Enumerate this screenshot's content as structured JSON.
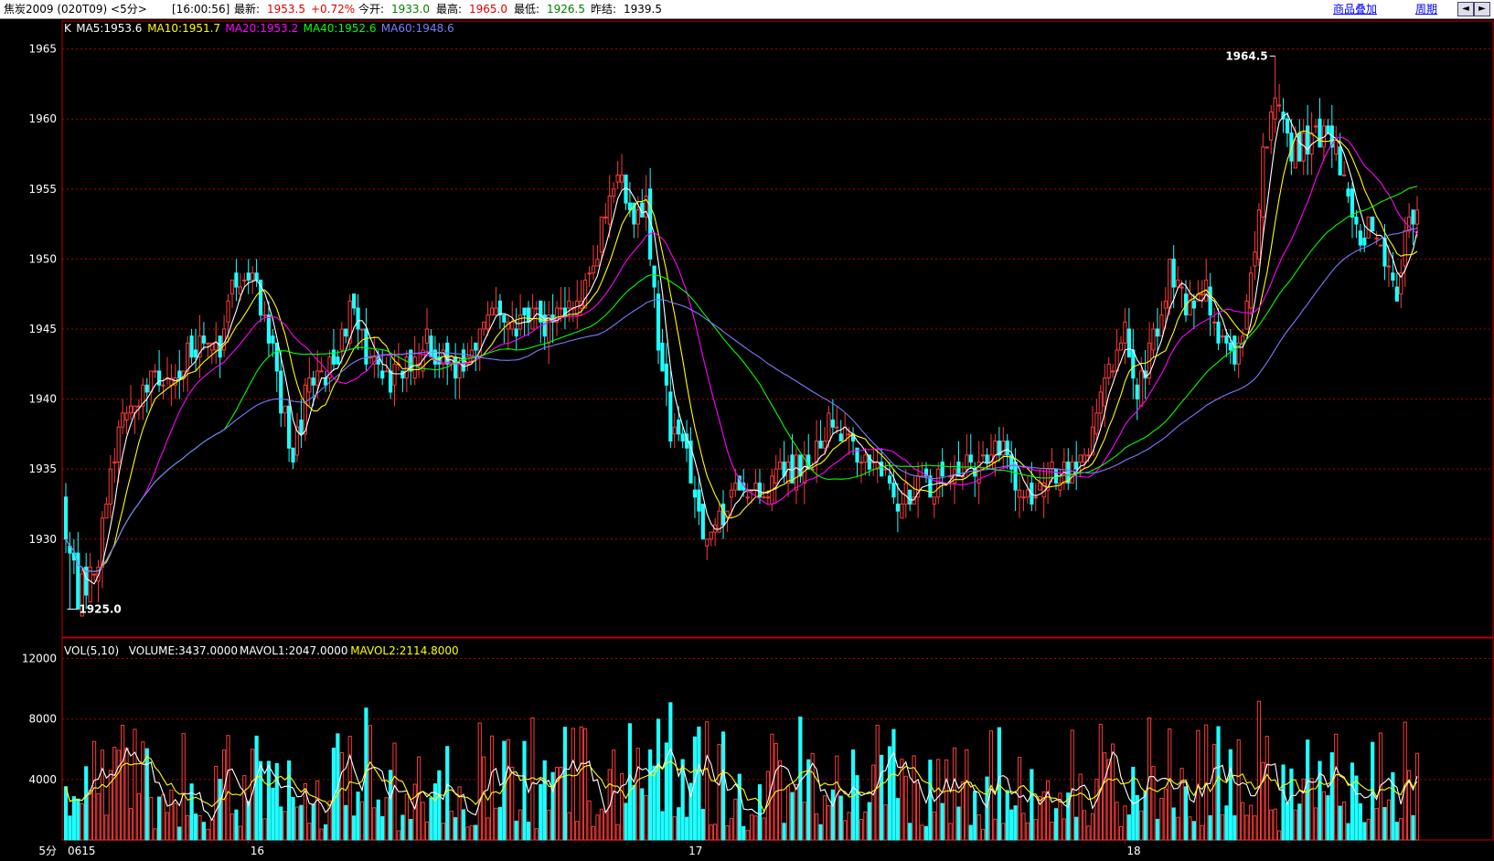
{
  "header": {
    "instrument": "焦炭2009 (020T09) <5分>",
    "time": "[16:00:56]",
    "last_label": "最新:",
    "last_value": "1953.5",
    "change": "+0.72%",
    "open_label": "今开:",
    "open_value": "1933.0",
    "high_label": "最高:",
    "high_value": "1965.0",
    "low_label": "最低:",
    "low_value": "1926.5",
    "prev_label": "昨结:",
    "prev_value": "1939.5",
    "overlay_link": "商品叠加",
    "period_link": "周期"
  },
  "colors": {
    "up": "#ff3a3a",
    "down": "#20ffff",
    "ma5": "#ffffff",
    "ma10": "#ffff00",
    "ma20": "#ff00ff",
    "ma40": "#00ff00",
    "ma60": "#7b7bff",
    "grid": "#b00000",
    "frame": "#c00000"
  },
  "price_legend": [
    {
      "text": "K",
      "color": "#ffffff"
    },
    {
      "text": "MA5:1953.6",
      "color": "#ffffff"
    },
    {
      "text": "MA10:1951.7",
      "color": "#ffff00"
    },
    {
      "text": "MA20:1953.2",
      "color": "#ff00ff"
    },
    {
      "text": "MA40:1952.6",
      "color": "#00ff00"
    },
    {
      "text": "MA60:1948.6",
      "color": "#7b7bff"
    }
  ],
  "vol_legend": [
    {
      "text": "VOL(5,10)",
      "color": "#ffffff"
    },
    {
      "text": "VOLUME:3437.0000",
      "color": "#ffffff"
    },
    {
      "text": "MAVOL1:2047.0000",
      "color": "#ffffff"
    },
    {
      "text": "MAVOL2:2114.8000",
      "color": "#ffff00"
    }
  ],
  "annotations": {
    "max_label": "1964.5",
    "min_label": "1925.0"
  },
  "period_label": "5分",
  "chart_data": {
    "type": "candlestick",
    "price_axis": {
      "min": 1923,
      "max": 1967,
      "ticks": [
        1930,
        1935,
        1940,
        1945,
        1950,
        1955,
        1960,
        1965
      ]
    },
    "volume_axis": {
      "min": 0,
      "max": 13000,
      "ticks": [
        4000,
        8000,
        12000
      ]
    },
    "x_labels": [
      {
        "index": 0,
        "text": "0615"
      },
      {
        "index": 45,
        "text": "16"
      },
      {
        "index": 153,
        "text": "17"
      },
      {
        "index": 261,
        "text": "18"
      }
    ],
    "candle_count": 334,
    "key_points": [
      {
        "i": 0,
        "p": 1931
      },
      {
        "i": 3,
        "p": 1926
      },
      {
        "i": 8,
        "p": 1929
      },
      {
        "i": 13,
        "p": 1938
      },
      {
        "i": 20,
        "p": 1941
      },
      {
        "i": 30,
        "p": 1943
      },
      {
        "i": 38,
        "p": 1944
      },
      {
        "i": 42,
        "p": 1949
      },
      {
        "i": 46,
        "p": 1948
      },
      {
        "i": 50,
        "p": 1945
      },
      {
        "i": 53,
        "p": 1940
      },
      {
        "i": 56,
        "p": 1936
      },
      {
        "i": 60,
        "p": 1941
      },
      {
        "i": 65,
        "p": 1942
      },
      {
        "i": 70,
        "p": 1946
      },
      {
        "i": 75,
        "p": 1943
      },
      {
        "i": 80,
        "p": 1941
      },
      {
        "i": 85,
        "p": 1943
      },
      {
        "i": 90,
        "p": 1944
      },
      {
        "i": 95,
        "p": 1942
      },
      {
        "i": 100,
        "p": 1944
      },
      {
        "i": 105,
        "p": 1946
      },
      {
        "i": 110,
        "p": 1945
      },
      {
        "i": 115,
        "p": 1946
      },
      {
        "i": 120,
        "p": 1945
      },
      {
        "i": 124,
        "p": 1947
      },
      {
        "i": 128,
        "p": 1948
      },
      {
        "i": 132,
        "p": 1952
      },
      {
        "i": 136,
        "p": 1956
      },
      {
        "i": 140,
        "p": 1953
      },
      {
        "i": 143,
        "p": 1954
      },
      {
        "i": 146,
        "p": 1944
      },
      {
        "i": 149,
        "p": 1938
      },
      {
        "i": 152,
        "p": 1937
      },
      {
        "i": 155,
        "p": 1934
      },
      {
        "i": 158,
        "p": 1929
      },
      {
        "i": 162,
        "p": 1932
      },
      {
        "i": 166,
        "p": 1934
      },
      {
        "i": 170,
        "p": 1934
      },
      {
        "i": 175,
        "p": 1934
      },
      {
        "i": 180,
        "p": 1935
      },
      {
        "i": 184,
        "p": 1936
      },
      {
        "i": 188,
        "p": 1938
      },
      {
        "i": 192,
        "p": 1937
      },
      {
        "i": 196,
        "p": 1936
      },
      {
        "i": 200,
        "p": 1935
      },
      {
        "i": 204,
        "p": 1933
      },
      {
        "i": 208,
        "p": 1933
      },
      {
        "i": 212,
        "p": 1934
      },
      {
        "i": 216,
        "p": 1934
      },
      {
        "i": 220,
        "p": 1935
      },
      {
        "i": 225,
        "p": 1935
      },
      {
        "i": 230,
        "p": 1937
      },
      {
        "i": 233,
        "p": 1935
      },
      {
        "i": 236,
        "p": 1932
      },
      {
        "i": 240,
        "p": 1934
      },
      {
        "i": 245,
        "p": 1935
      },
      {
        "i": 250,
        "p": 1935
      },
      {
        "i": 254,
        "p": 1938
      },
      {
        "i": 258,
        "p": 1943
      },
      {
        "i": 261,
        "p": 1945
      },
      {
        "i": 264,
        "p": 1941
      },
      {
        "i": 268,
        "p": 1944
      },
      {
        "i": 272,
        "p": 1949
      },
      {
        "i": 276,
        "p": 1947
      },
      {
        "i": 280,
        "p": 1948
      },
      {
        "i": 284,
        "p": 1945
      },
      {
        "i": 288,
        "p": 1943
      },
      {
        "i": 292,
        "p": 1948
      },
      {
        "i": 295,
        "p": 1957
      },
      {
        "i": 298,
        "p": 1962
      },
      {
        "i": 302,
        "p": 1958
      },
      {
        "i": 306,
        "p": 1958
      },
      {
        "i": 310,
        "p": 1959
      },
      {
        "i": 313,
        "p": 1958
      },
      {
        "i": 316,
        "p": 1954
      },
      {
        "i": 319,
        "p": 1951
      },
      {
        "i": 322,
        "p": 1953
      },
      {
        "i": 325,
        "p": 1949
      },
      {
        "i": 328,
        "p": 1948
      },
      {
        "i": 331,
        "p": 1953
      },
      {
        "i": 333,
        "p": 1953.5
      }
    ],
    "extremes": {
      "high": 1964.5,
      "high_index": 298,
      "low": 1925.0,
      "low_index": 1
    }
  }
}
